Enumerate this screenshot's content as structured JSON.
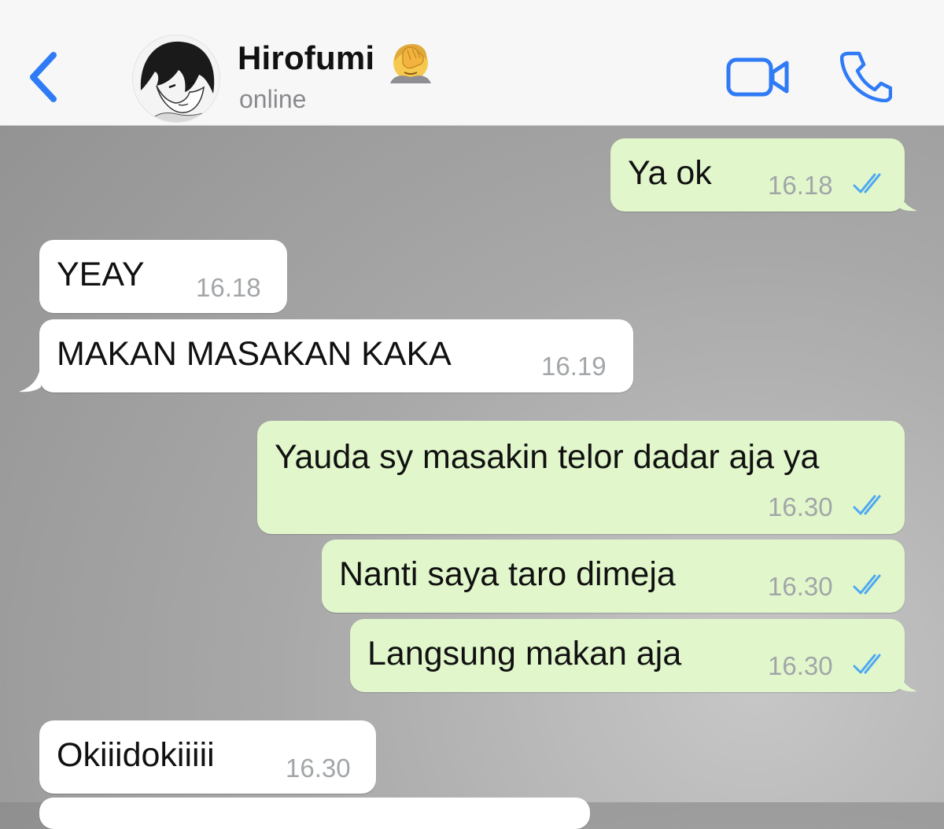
{
  "header": {
    "contact_name": "Hirofumi",
    "status": "online"
  },
  "messages": [
    {
      "direction": "outgoing",
      "text": "Ya ok",
      "time": "16.18",
      "read": true
    },
    {
      "direction": "incoming",
      "text": "YEAY",
      "time": "16.18"
    },
    {
      "direction": "incoming",
      "text": "MAKAN MASAKAN KAKA",
      "time": "16.19"
    },
    {
      "direction": "outgoing",
      "text": "Yauda sy masakin telor dadar aja ya",
      "time": "16.30",
      "read": true
    },
    {
      "direction": "outgoing",
      "text": "Nanti saya taro dimeja",
      "time": "16.30",
      "read": true
    },
    {
      "direction": "outgoing",
      "text": "Langsung makan aja",
      "time": "16.30",
      "read": true
    },
    {
      "direction": "incoming",
      "text": "Okiiidokiiiii",
      "time": "16.30"
    }
  ],
  "colors": {
    "accent": "#2f7bf6",
    "outgoing_bubble": "#e1f7cb",
    "incoming_bubble": "#ffffff",
    "read_tick": "#4fa9f0"
  },
  "icons": {
    "back": "chevron-left-icon",
    "video": "video-camera-icon",
    "call": "phone-icon",
    "emoji": "face-palm-emoji",
    "read": "double-check-icon"
  }
}
